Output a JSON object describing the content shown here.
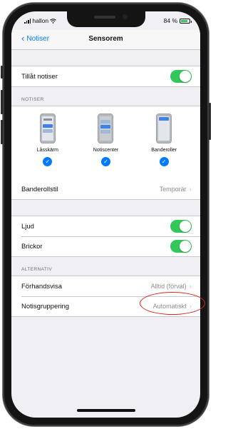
{
  "status": {
    "carrier": "hallon",
    "battery": "84 %",
    "battery_level": 0.84
  },
  "nav": {
    "back_label": "Notiser",
    "title": "Sensorem"
  },
  "allow": {
    "label": "Tillåt notiser",
    "on": true
  },
  "notiser_header": "NOTISER",
  "styles": [
    {
      "label": "Låsskärm",
      "selected": true
    },
    {
      "label": "Notiscenter",
      "selected": true
    },
    {
      "label": "Banderoller",
      "selected": true
    }
  ],
  "banner_style": {
    "label": "Banderollstil",
    "value": "Temporär"
  },
  "sound": {
    "label": "Ljud",
    "on": true
  },
  "badges": {
    "label": "Brickor",
    "on": true
  },
  "alternativ_header": "ALTERNATIV",
  "preview": {
    "label": "Förhandsvisa",
    "value": "Alltid (förval)"
  },
  "grouping": {
    "label": "Notisgruppering",
    "value": "Automatiskt"
  },
  "colors": {
    "accent": "#007aff",
    "toggle_on": "#34c759",
    "annotation": "#d9251c"
  }
}
